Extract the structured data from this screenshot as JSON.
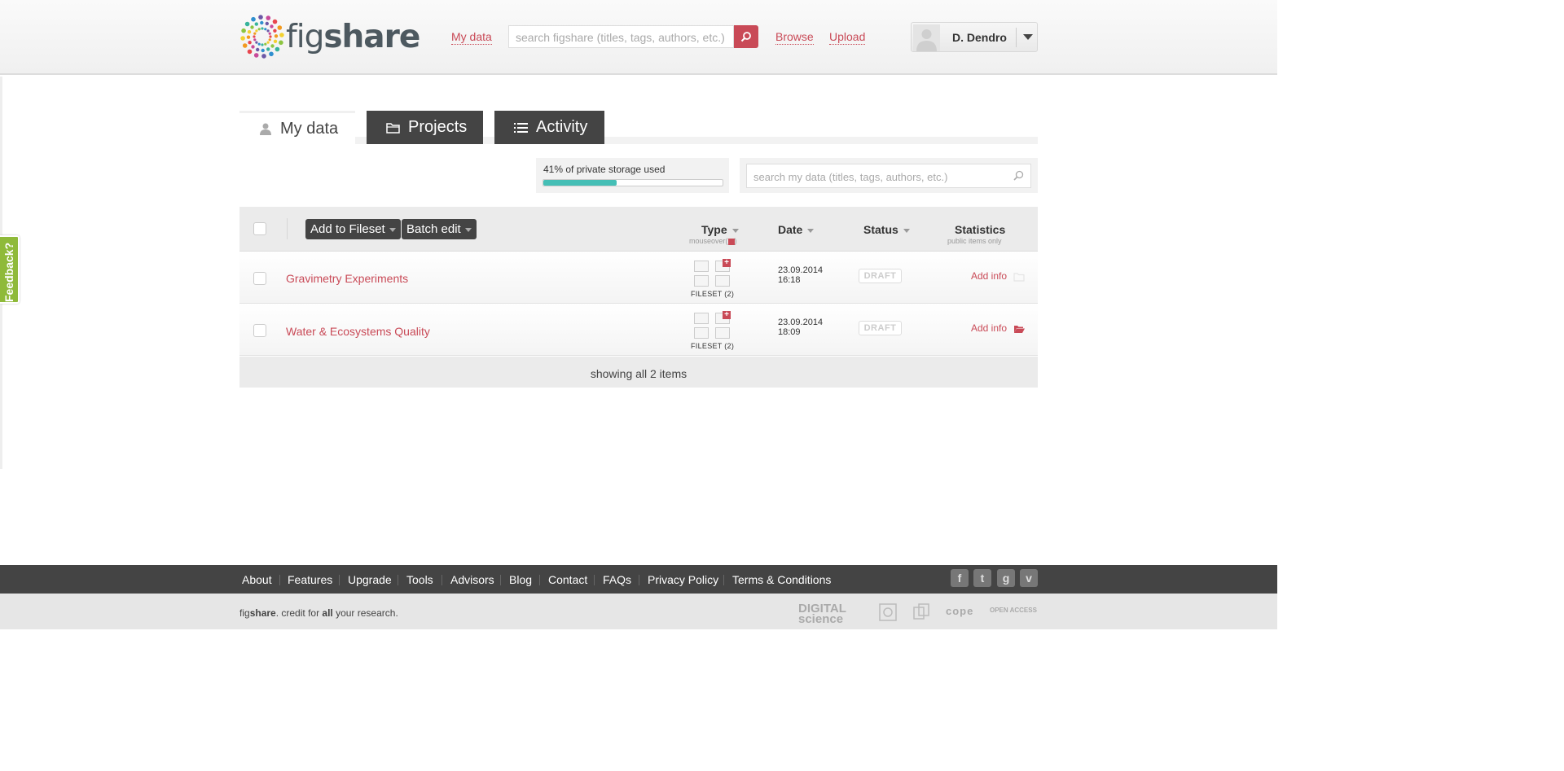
{
  "header": {
    "logo_fig": "fig",
    "logo_share": "share",
    "my_data_link": "My data",
    "search_placeholder": "search figshare (titles, tags, authors, etc.)",
    "browse_link": "Browse",
    "upload_link": "Upload",
    "user_name": "D. Dendro"
  },
  "tabs": [
    {
      "label": "My data",
      "icon": "user-icon",
      "active": true
    },
    {
      "label": "Projects",
      "icon": "folder-icon",
      "active": false
    },
    {
      "label": "Activity",
      "icon": "list-icon",
      "active": false
    }
  ],
  "storage": {
    "text": "41% of private storage used",
    "fraction": 0.41,
    "color": "#45bfb6"
  },
  "my_search_placeholder": "search my data (titles, tags, authors, etc.)",
  "toolbar": {
    "add_to_fileset": "Add to Fileset",
    "batch_edit": "Batch edit"
  },
  "columns": {
    "type": "Type",
    "type_sub": "mouseover(",
    "type_sub_end": ")",
    "date": "Date",
    "status": "Status",
    "statistics": "Statistics",
    "statistics_sub": "public items only"
  },
  "rows": [
    {
      "title": "Gravimetry Experiments",
      "type": "FILESET (2)",
      "date": "23.09.2014",
      "time": "16:18",
      "status": "DRAFT",
      "action": "Add info"
    },
    {
      "title": "Water & Ecosystems Quality",
      "type": "FILESET (2)",
      "date": "23.09.2014",
      "time": "18:09",
      "status": "DRAFT",
      "action": "Add info"
    }
  ],
  "showing": "showing all 2 items",
  "feedback": "Feedback?",
  "footer": {
    "links": [
      "About",
      "Features",
      "Upgrade",
      "Tools",
      "Advisors",
      "Blog",
      "Contact",
      "FAQs",
      "Privacy Policy",
      "Terms & Conditions"
    ],
    "tagline_brand_a": "fig",
    "tagline_brand_b": "share",
    "tagline_a": ". credit for ",
    "tagline_b": "all",
    "tagline_c": " your research.",
    "social": [
      "f",
      "t",
      "g",
      "v"
    ],
    "partners": [
      "DIGITAL science",
      "",
      "",
      "cope",
      "OPEN ACCESS"
    ]
  },
  "colors": {
    "accent": "#c94a57",
    "dark": "#444444",
    "feedback": "#8fba3a"
  }
}
